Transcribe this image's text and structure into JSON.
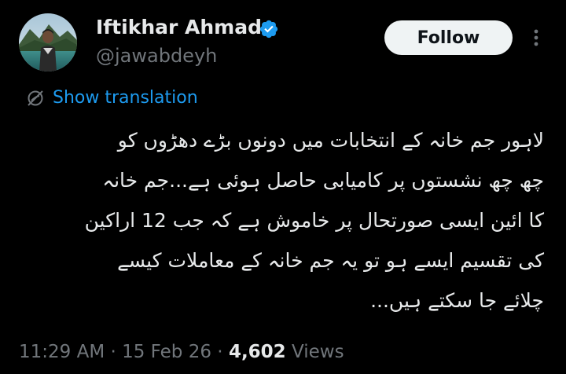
{
  "author": {
    "display_name": "Iftikhar Ahmad",
    "handle": "@jawabdeyh",
    "verified_icon": "verified-badge-icon",
    "verified_color": "#1d9bf0"
  },
  "actions": {
    "follow_label": "Follow",
    "more_icon": "more-options-icon"
  },
  "translation": {
    "icon": "globe-slash-icon",
    "label": "Show translation",
    "color": "#1d9bf0"
  },
  "tweet": {
    "lines": [
      "لاہور جم خانہ کے انتخابات میں دونوں بڑے دھڑوں کو",
      "چھ چھ نشستوں پر کامیابی حاصل ہوئی ہے...جم خانہ",
      "کا ائین ایسی صورتحال پر خاموش ہے کہ جب 12 اراکین",
      "کی تقسیم ایسے ہو تو یہ جم خانہ کے معاملات کیسے",
      "چلائے جا سکتے ہیں..."
    ]
  },
  "meta": {
    "time": "11:29 AM",
    "separator": " · ",
    "date": "15 Feb 26",
    "views_count": "4,602",
    "views_label": " Views"
  },
  "colors": {
    "background": "#000000",
    "text_primary": "#e7e9ea",
    "text_secondary": "#71767b",
    "accent": "#1d9bf0",
    "button_bg": "#eff3f4"
  }
}
